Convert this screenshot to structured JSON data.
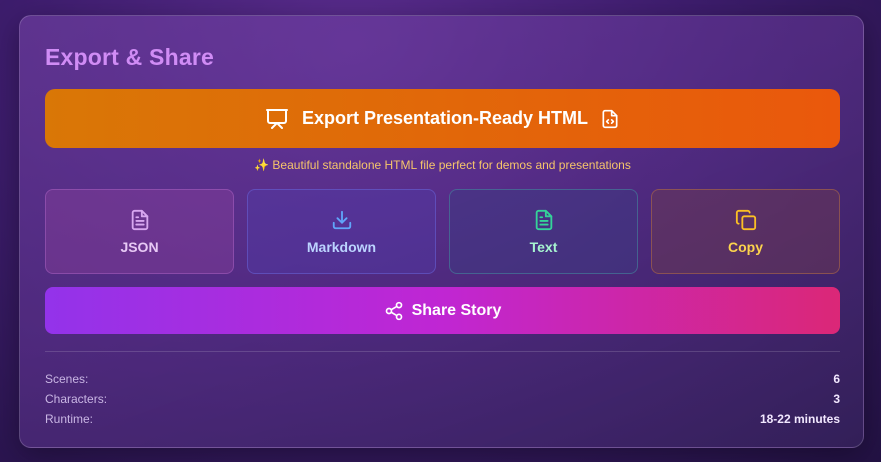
{
  "panel": {
    "title": "Export & Share"
  },
  "export_button": {
    "label": "Export Presentation-Ready HTML",
    "lead_icon": "presentation-icon",
    "trail_icon": "file-code-icon",
    "color_start": "#d97706",
    "color_end": "#ea580c"
  },
  "hint": {
    "text": "✨ Beautiful standalone HTML file perfect for demos and presentations"
  },
  "formats": [
    {
      "label": "JSON",
      "icon": "file-text-icon",
      "color": "#e7c9f5"
    },
    {
      "label": "Markdown",
      "icon": "download-icon",
      "color": "#60a5fa"
    },
    {
      "label": "Text",
      "icon": "file-text-icon",
      "color": "#34d399"
    },
    {
      "label": "Copy",
      "icon": "copy-icon",
      "color": "#fbbf24"
    }
  ],
  "share_button": {
    "label": "Share Story",
    "icon": "share-icon"
  },
  "stats": [
    {
      "key": "Scenes:",
      "value": "6"
    },
    {
      "key": "Characters:",
      "value": "3"
    },
    {
      "key": "Runtime:",
      "value": "18-22 minutes"
    }
  ]
}
